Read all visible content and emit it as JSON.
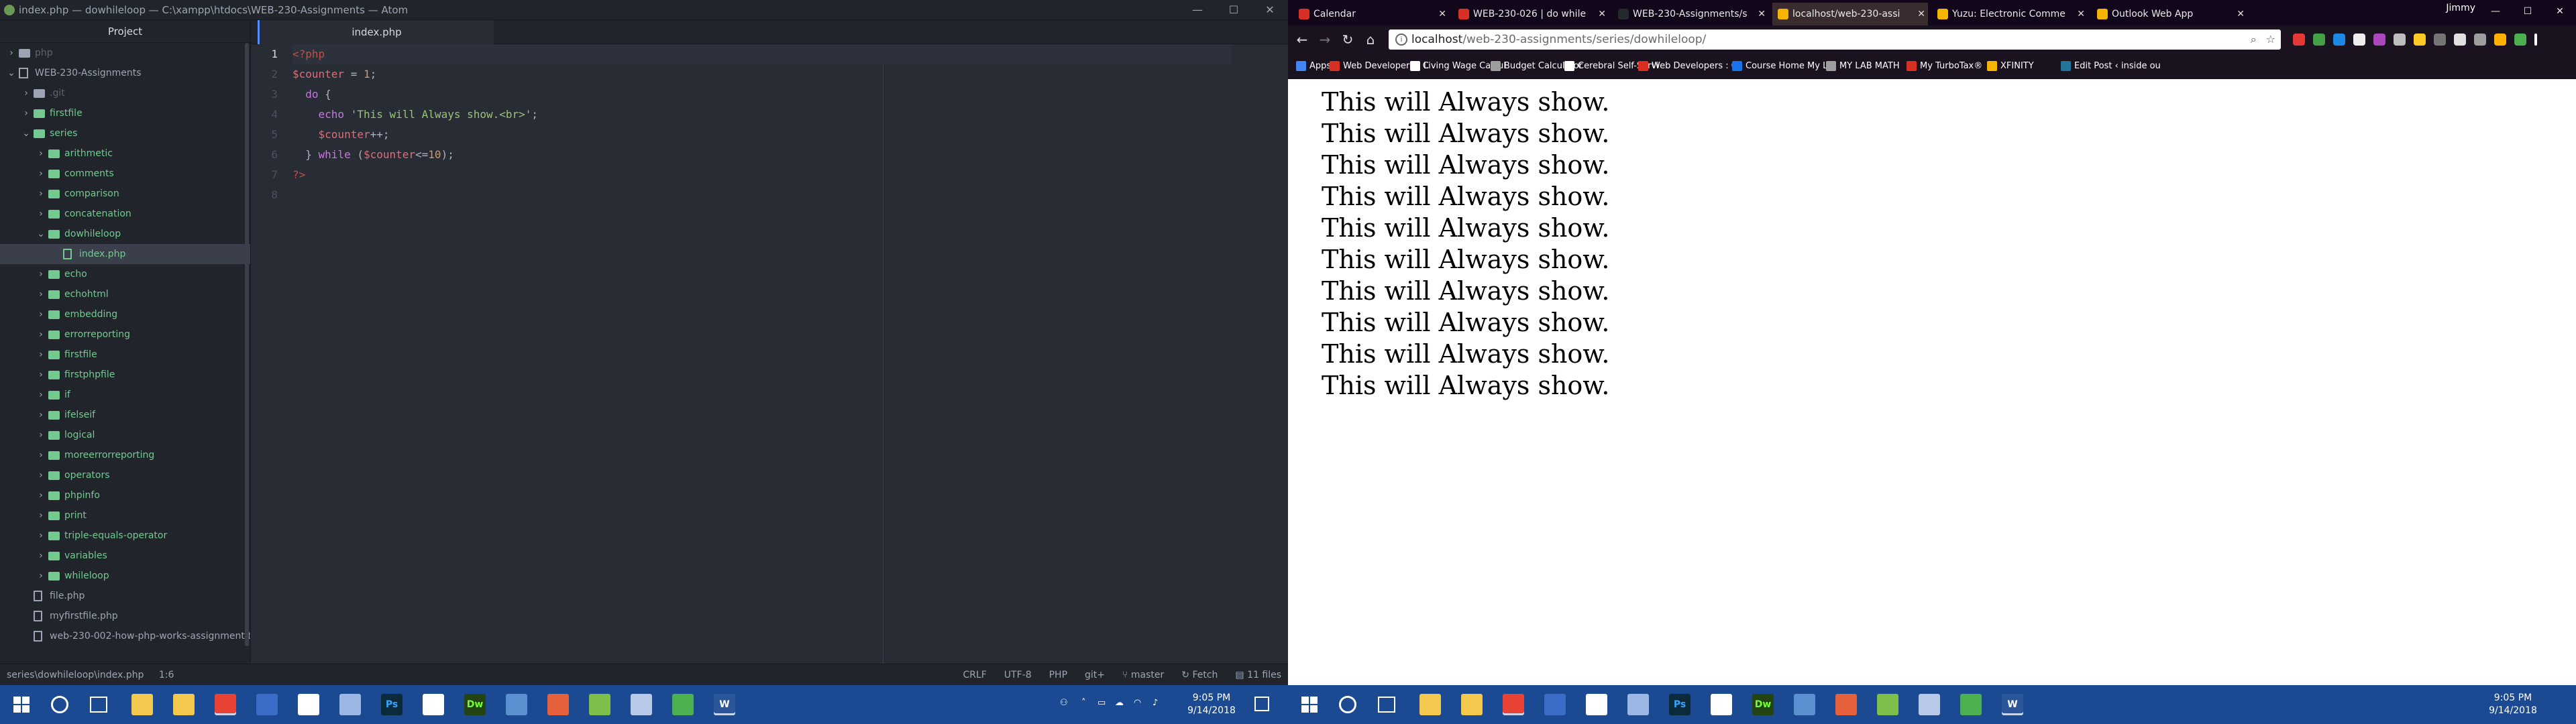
{
  "atom": {
    "title": "index.php — dowhileloop — C:\\xampp\\htdocs\\WEB-230-Assignments — Atom",
    "window_controls": [
      "—",
      "☐",
      "✕"
    ],
    "tree_header": "Project",
    "tree": [
      {
        "label": "php",
        "type": "folder",
        "chev": "›",
        "indent": 0,
        "color": "dim"
      },
      {
        "label": "WEB-230-Assignments",
        "type": "repo",
        "chev": "⌄",
        "indent": 0,
        "color": "normal"
      },
      {
        "label": ".git",
        "type": "folder",
        "chev": "›",
        "indent": 1,
        "color": "dim"
      },
      {
        "label": "firstfile",
        "type": "folder",
        "chev": "›",
        "indent": 1,
        "color": "green"
      },
      {
        "label": "series",
        "type": "folder",
        "chev": "⌄",
        "indent": 1,
        "color": "green"
      },
      {
        "label": "arithmetic",
        "type": "folder",
        "chev": "›",
        "indent": 2,
        "color": "green"
      },
      {
        "label": "comments",
        "type": "folder",
        "chev": "›",
        "indent": 2,
        "color": "green"
      },
      {
        "label": "comparison",
        "type": "folder",
        "chev": "›",
        "indent": 2,
        "color": "green"
      },
      {
        "label": "concatenation",
        "type": "folder",
        "chev": "›",
        "indent": 2,
        "color": "green"
      },
      {
        "label": "dowhileloop",
        "type": "folder",
        "chev": "⌄",
        "indent": 2,
        "color": "green"
      },
      {
        "label": "index.php",
        "type": "file",
        "chev": "",
        "indent": 3,
        "color": "green",
        "selected": true
      },
      {
        "label": "echo",
        "type": "folder",
        "chev": "›",
        "indent": 2,
        "color": "green"
      },
      {
        "label": "echohtml",
        "type": "folder",
        "chev": "›",
        "indent": 2,
        "color": "green"
      },
      {
        "label": "embedding",
        "type": "folder",
        "chev": "›",
        "indent": 2,
        "color": "green"
      },
      {
        "label": "errorreporting",
        "type": "folder",
        "chev": "›",
        "indent": 2,
        "color": "green"
      },
      {
        "label": "firstfile",
        "type": "folder",
        "chev": "›",
        "indent": 2,
        "color": "green"
      },
      {
        "label": "firstphpfile",
        "type": "folder",
        "chev": "›",
        "indent": 2,
        "color": "green"
      },
      {
        "label": "if",
        "type": "folder",
        "chev": "›",
        "indent": 2,
        "color": "green"
      },
      {
        "label": "ifelseif",
        "type": "folder",
        "chev": "›",
        "indent": 2,
        "color": "green"
      },
      {
        "label": "logical",
        "type": "folder",
        "chev": "›",
        "indent": 2,
        "color": "green"
      },
      {
        "label": "moreerrorreporting",
        "type": "folder",
        "chev": "›",
        "indent": 2,
        "color": "green"
      },
      {
        "label": "operators",
        "type": "folder",
        "chev": "›",
        "indent": 2,
        "color": "green"
      },
      {
        "label": "phpinfo",
        "type": "folder",
        "chev": "›",
        "indent": 2,
        "color": "green"
      },
      {
        "label": "print",
        "type": "folder",
        "chev": "›",
        "indent": 2,
        "color": "green"
      },
      {
        "label": "triple-equals-operator",
        "type": "folder",
        "chev": "›",
        "indent": 2,
        "color": "green"
      },
      {
        "label": "variables",
        "type": "folder",
        "chev": "›",
        "indent": 2,
        "color": "green"
      },
      {
        "label": "whileloop",
        "type": "folder",
        "chev": "›",
        "indent": 2,
        "color": "green"
      },
      {
        "label": "file.php",
        "type": "file",
        "chev": "",
        "indent": 1,
        "color": "normal"
      },
      {
        "label": "myfirstfile.php",
        "type": "file",
        "chev": "",
        "indent": 1,
        "color": "normal"
      },
      {
        "label": "web-230-002-how-php-works-assignment.t",
        "type": "file",
        "chev": "",
        "indent": 1,
        "color": "normal"
      }
    ],
    "tab_label": "index.php",
    "line_numbers": [
      "1",
      "2",
      "3",
      "4",
      "5",
      "6",
      "7",
      "8"
    ],
    "current_line": 1,
    "status": {
      "path": "series\\dowhileloop\\index.php",
      "cursor": "1:6",
      "line_ending": "CRLF",
      "encoding": "UTF-8",
      "grammar": "PHP",
      "git": "git+",
      "branch": "master",
      "fetch": "Fetch",
      "files": "11 files"
    }
  },
  "chrome": {
    "tabs": [
      {
        "title": "Calendar",
        "color": "#d93025"
      },
      {
        "title": "WEB-230-026 | do while",
        "color": "#d93025"
      },
      {
        "title": "WEB-230-Assignments/s",
        "color": "#24292e"
      },
      {
        "title": "localhost/web-230-assi",
        "color": "#f4b400",
        "active": true
      },
      {
        "title": "Yuzu: Electronic Comme",
        "color": "#f4b400"
      },
      {
        "title": "Outlook Web App",
        "color": "#f4b400"
      }
    ],
    "profile": "Jimmy",
    "window_controls": [
      "—",
      "☐",
      "✕"
    ],
    "url_host": "localhost",
    "url_path": "/web-230-assignments/series/dowhileloop/",
    "bookmarks": [
      {
        "label": "Apps",
        "color": "#4285f4"
      },
      {
        "label": "Web Developers : C",
        "color": "#d93025"
      },
      {
        "label": "Living Wage Calcul",
        "color": "#ffffff"
      },
      {
        "label": "Budget Calculator",
        "color": "#9e9e9e"
      },
      {
        "label": "Cerebral Self-Servi",
        "color": "#ffffff"
      },
      {
        "label": "Web Developers : C",
        "color": "#d93025"
      },
      {
        "label": "Course Home My La",
        "color": "#1a73e8"
      },
      {
        "label": "MY LAB MATH",
        "color": "#9e9e9e"
      },
      {
        "label": "My TurboTax®",
        "color": "#d93025"
      },
      {
        "label": "XFINITY",
        "color": "#f4b400"
      },
      {
        "label": "Edit Post ‹ inside ou",
        "color": "#21759b"
      }
    ],
    "output_line": "This will Always show.",
    "output_count": 10
  },
  "taskbar": {
    "time": "9:05 PM",
    "date": "9/14/2018",
    "apps": [
      {
        "name": "file-explorer",
        "glyph": "",
        "color": "#f2c94c"
      },
      {
        "name": "store",
        "glyph": "",
        "color": "#f2c94c"
      },
      {
        "name": "chrome",
        "glyph": "",
        "color": "#e94235"
      },
      {
        "name": "maps",
        "glyph": "",
        "color": "#3b6cc7"
      },
      {
        "name": "mail",
        "glyph": "",
        "color": "#ffffff"
      },
      {
        "name": "onenote",
        "glyph": "",
        "color": "#9bb7e4"
      },
      {
        "name": "photoshop",
        "glyph": "Ps",
        "color": "#0b2a3a"
      },
      {
        "name": "app-arrow",
        "glyph": "",
        "color": "#ffffff"
      },
      {
        "name": "dreamweaver",
        "glyph": "Dw",
        "color": "#234412"
      },
      {
        "name": "word-doc",
        "glyph": "",
        "color": "#5a8fd0"
      },
      {
        "name": "xampp",
        "glyph": "",
        "color": "#e5603b"
      },
      {
        "name": "app-green",
        "glyph": "",
        "color": "#7cbf4a"
      },
      {
        "name": "app-cloud",
        "glyph": "",
        "color": "#b8c8e8"
      },
      {
        "name": "sticky",
        "glyph": "",
        "color": "#4caf50"
      },
      {
        "name": "word",
        "glyph": "W",
        "color": "#2b579a"
      }
    ]
  }
}
